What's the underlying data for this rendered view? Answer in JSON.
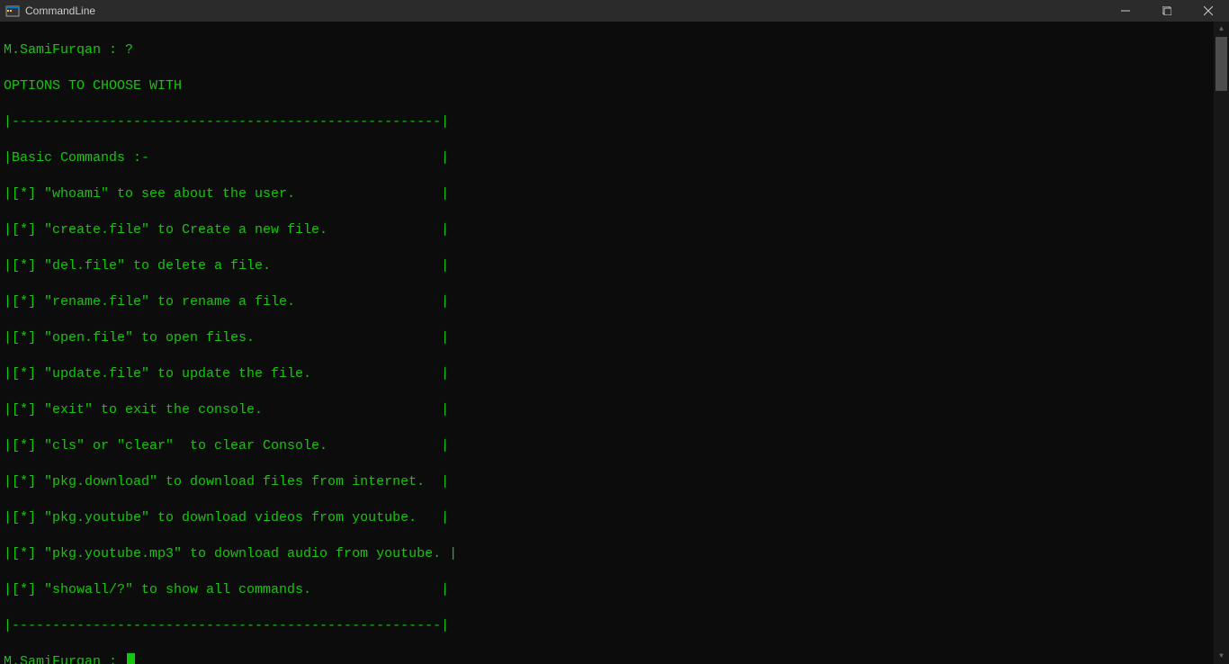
{
  "window": {
    "title": "CommandLine"
  },
  "terminal": {
    "prompt_line": "M.SamiFurqan : ?",
    "header": "OPTIONS TO CHOOSE WITH",
    "border": "|-----------------------------------------------------|",
    "section_title": "|Basic Commands :-                                    |",
    "commands": [
      "|[*] \"whoami\" to see about the user.                  |",
      "|[*] \"create.file\" to Create a new file.              |",
      "|[*] \"del.file\" to delete a file.                     |",
      "|[*] \"rename.file\" to rename a file.                  |",
      "|[*] \"open.file\" to open files.                       |",
      "|[*] \"update.file\" to update the file.                |",
      "|[*] \"exit\" to exit the console.                      |",
      "|[*] \"cls\" or \"clear\"  to clear Console.              |",
      "|[*] \"pkg.download\" to download files from internet.  |",
      "|[*] \"pkg.youtube\" to download videos from youtube.   |",
      "|[*] \"pkg.youtube.mp3\" to download audio from youtube. |",
      "|[*] \"showall/?\" to show all commands.                |"
    ],
    "border_bottom": "|-----------------------------------------------------|",
    "prompt_current": "M.SamiFurqan : "
  }
}
